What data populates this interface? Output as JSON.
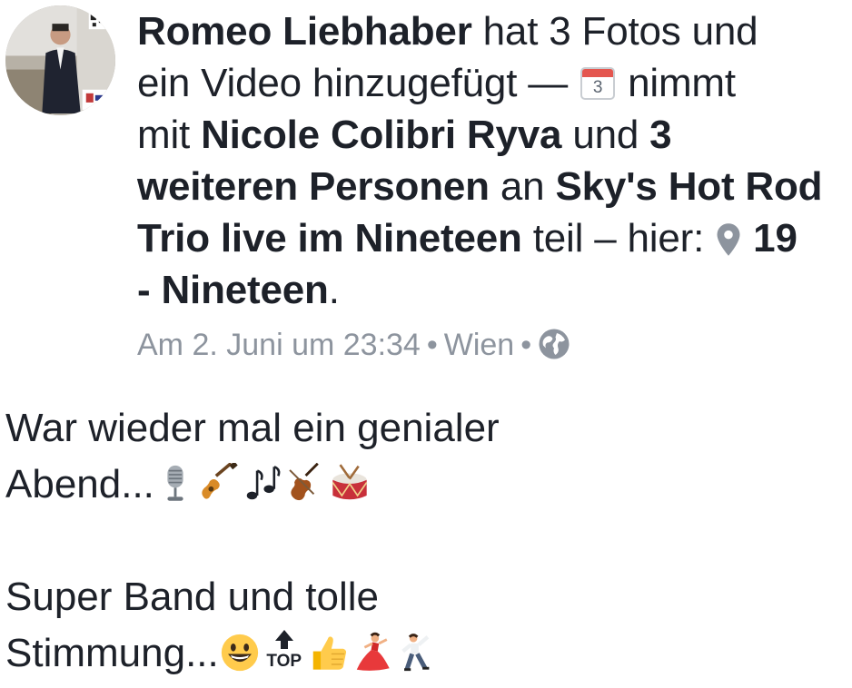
{
  "post_header": {
    "author": "Romeo Liebhaber",
    "action_1": " hat 3 Fotos und",
    "action_2": "ein Video hinzugefügt — ",
    "calendar_day": "3",
    "action_3": " nimmt",
    "with_prefix": "mit ",
    "tagged_person": "Nicole Colibri Ryva",
    "and_word": " und ",
    "others_1": "3",
    "others_2": "weiteren Personen",
    "at_word": " an ",
    "event_1": "Sky's Hot Rod",
    "event_2": "Trio live im Nineteen",
    "participate_here": " teil – hier: ",
    "place_1": "19",
    "place_2": "- Nineteen",
    "period": "."
  },
  "meta": {
    "timestamp": "Am 2. Juni um 23:34",
    "separator": "•",
    "location": "Wien",
    "privacy_icon": "globe-icon"
  },
  "post_body": {
    "line_1": "War wieder mal ein genialer",
    "line_2": "Abend...",
    "line_2_emojis": [
      "microphone-emoji",
      "guitar-emoji",
      "music-notes-emoji",
      "violin-emoji",
      "drum-emoji"
    ],
    "line_3": "Super Band und tolle",
    "line_4": "Stimmung...",
    "top_label": "TOP",
    "line_4_emojis": [
      "grinning-face-emoji",
      "top-arrow-emoji",
      "thumbs-up-emoji",
      "dancer-emoji",
      "man-dancing-emoji"
    ]
  },
  "colors": {
    "text": "#1d2129",
    "meta_text": "#8d949e",
    "calendar_red": "#e4564f"
  }
}
